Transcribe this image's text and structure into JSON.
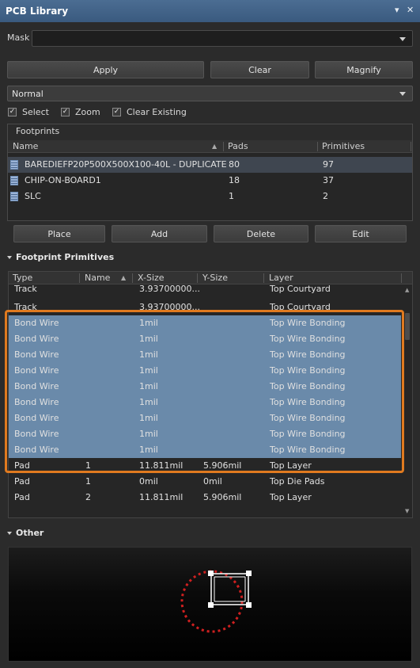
{
  "window": {
    "title": "PCB Library",
    "controls": [
      "▾",
      "✕"
    ]
  },
  "mask": {
    "label": "Mask",
    "value": ""
  },
  "buttons": {
    "apply": "Apply",
    "clear": "Clear",
    "magnify": "Magnify"
  },
  "mode": {
    "value": "Normal"
  },
  "options": {
    "select": "Select",
    "zoom": "Zoom",
    "clear_existing": "Clear Existing"
  },
  "footprints": {
    "title": "Footprints",
    "columns": {
      "name": "Name",
      "pads": "Pads",
      "primitives": "Primitives"
    },
    "rows": [
      {
        "name": "BAREDIEFP20P500X500X100-40L - DUPLICATE",
        "pads": "80",
        "primitives": "97",
        "selected": true
      },
      {
        "name": "CHIP-ON-BOARD1",
        "pads": "18",
        "primitives": "37"
      },
      {
        "name": "SLC",
        "pads": "1",
        "primitives": "2"
      }
    ],
    "actions": {
      "place": "Place",
      "add": "Add",
      "delete": "Delete",
      "edit": "Edit"
    }
  },
  "primitives": {
    "title": "Footprint Primitives",
    "columns": {
      "type": "Type",
      "name": "Name",
      "xsize": "X-Size",
      "ysize": "Y-Size",
      "layer": "Layer"
    },
    "rows": [
      {
        "type": "Track",
        "name": "",
        "xsize": "3.93700000...",
        "ysize": "",
        "layer": "Top Courtyard"
      },
      {
        "type": "Track",
        "name": "",
        "xsize": "3.93700000...",
        "ysize": "",
        "layer": "Top Courtyard"
      },
      {
        "type": "Bond Wire",
        "name": "",
        "xsize": "1mil",
        "ysize": "",
        "layer": "Top Wire Bonding",
        "highlight": true
      },
      {
        "type": "Bond Wire",
        "name": "",
        "xsize": "1mil",
        "ysize": "",
        "layer": "Top Wire Bonding",
        "highlight": true
      },
      {
        "type": "Bond Wire",
        "name": "",
        "xsize": "1mil",
        "ysize": "",
        "layer": "Top Wire Bonding",
        "highlight": true
      },
      {
        "type": "Bond Wire",
        "name": "",
        "xsize": "1mil",
        "ysize": "",
        "layer": "Top Wire Bonding",
        "highlight": true
      },
      {
        "type": "Bond Wire",
        "name": "",
        "xsize": "1mil",
        "ysize": "",
        "layer": "Top Wire Bonding",
        "highlight": true
      },
      {
        "type": "Bond Wire",
        "name": "",
        "xsize": "1mil",
        "ysize": "",
        "layer": "Top Wire Bonding",
        "highlight": true
      },
      {
        "type": "Bond Wire",
        "name": "",
        "xsize": "1mil",
        "ysize": "",
        "layer": "Top Wire Bonding",
        "highlight": true
      },
      {
        "type": "Bond Wire",
        "name": "",
        "xsize": "1mil",
        "ysize": "",
        "layer": "Top Wire Bonding",
        "highlight": true
      },
      {
        "type": "Bond Wire",
        "name": "",
        "xsize": "1mil",
        "ysize": "",
        "layer": "Top Wire Bonding",
        "highlight": true
      },
      {
        "type": "Pad",
        "name": "1",
        "xsize": "11.811mil",
        "ysize": "5.906mil",
        "layer": "Top Layer"
      },
      {
        "type": "Pad",
        "name": "1",
        "xsize": "0mil",
        "ysize": "0mil",
        "layer": "Top Die Pads"
      },
      {
        "type": "Pad",
        "name": "2",
        "xsize": "11.811mil",
        "ysize": "5.906mil",
        "layer": "Top Layer"
      }
    ]
  },
  "other": {
    "title": "Other"
  },
  "colors": {
    "highlight_border": "#e07a1f",
    "bond_row": "#6a8aaa",
    "accent_red": "#d02020"
  }
}
